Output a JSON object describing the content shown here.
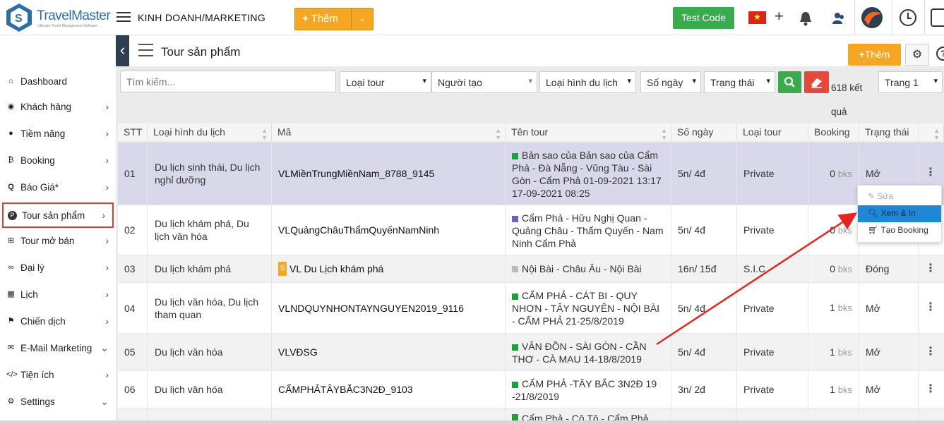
{
  "topbar": {
    "logo_text": "TravelMaster",
    "logo_sub": "Ultimate Travel Management Software",
    "section": "KINH DOANH/MARKETING",
    "add_label": "Thêm",
    "test_code": "Test Code"
  },
  "sidebar": {
    "items": [
      {
        "label": "Dashboard",
        "icon": "home-icon",
        "arrow": ""
      },
      {
        "label": "Khách hàng",
        "icon": "user-circle-icon",
        "arrow": "›"
      },
      {
        "label": "Tiềm năng",
        "icon": "chat-icon",
        "arrow": "›"
      },
      {
        "label": "Booking",
        "icon": "bitcoin-icon",
        "arrow": "›"
      },
      {
        "label": "Báo Giá*",
        "icon": "quote-icon",
        "arrow": "›"
      },
      {
        "label": "Tour sản phẩm",
        "icon": "product-icon",
        "arrow": "›"
      },
      {
        "label": "Tour mở bán",
        "icon": "sitemap-icon",
        "arrow": "›"
      },
      {
        "label": "Đại lý",
        "icon": "handshake-icon",
        "arrow": "›"
      },
      {
        "label": "Lịch",
        "icon": "calendar-icon",
        "arrow": "›"
      },
      {
        "label": "Chiến dịch",
        "icon": "flag-icon",
        "arrow": "›"
      },
      {
        "label": "E-Mail Marketing",
        "icon": "mail-icon",
        "arrow": "⌄"
      },
      {
        "label": "Tiện ích",
        "icon": "code-icon",
        "arrow": "›"
      },
      {
        "label": "Settings",
        "icon": "cogs-icon",
        "arrow": "⌄"
      }
    ]
  },
  "page": {
    "title": "Tour sản phẩm",
    "add_label": "Thêm"
  },
  "filters": {
    "search_placeholder": "Tìm kiếm...",
    "loai_tour": "Loại tour",
    "nguoi_tao": "Người tạo",
    "loai_hinh": "Loại hình du lịch",
    "so_ngay": "Số ngày",
    "trang_thai": "Trạng thái",
    "result_count": "618 kết quả",
    "page": "Trang 1"
  },
  "table": {
    "headers": [
      "STT",
      "Loại hình du lịch",
      "Mã",
      "Tên tour",
      "Số ngày",
      "Loại tour",
      "Booking",
      "Trạng thái"
    ],
    "rows": [
      {
        "stt": "01",
        "loai_hinh": "Du lịch sinh thái, Du lịch nghỉ dưỡng",
        "ma": "VLMiềnTrungMiềnNam_8788_9145",
        "ten": "Bản sao của Bản sao của Cẩm Phả - Đà Nẵng - Vũng Tàu - Sài Gòn - Cẩm Phả 01-09-2021 13:17 17-09-2021 08:25",
        "color": "#1aa33a",
        "so_ngay": "5n/ 4đ",
        "loai_tour": "Private",
        "booking": "0",
        "unit": "bks",
        "trang_thai": "Mở"
      },
      {
        "stt": "02",
        "loai_hinh": "Du lịch khám phá, Du lịch văn hóa",
        "ma": "VLQuảngChâuThẩmQuyếnNamNinh",
        "ten": "Cẩm Phả - Hữu Nghị Quan - Quảng Châu - Thẩm Quyến - Nam Ninh Cẩm Phả",
        "color": "#6b5fc7",
        "so_ngay": "5n/ 4đ",
        "loai_tour": "Private",
        "booking": "0",
        "unit": "bks",
        "trang_thai": ""
      },
      {
        "stt": "03",
        "loai_hinh": "Du lịch khám phá",
        "ma": "VL Du Lịch khám phá",
        "ten": "Nội Bài - Châu Âu - Nội Bài",
        "color": "#bbbbbb",
        "so_ngay": "16n/ 15đ",
        "loai_tour": "S.I.C",
        "booking": "0",
        "unit": "bks",
        "trang_thai": "Đóng",
        "tag": "S"
      },
      {
        "stt": "04",
        "loai_hinh": "Du lịch văn hóa, Du lịch tham quan",
        "ma": "VLNDQUYNHONTAYNGUYEN2019_9116",
        "ten": "CẨM PHẢ - CÁT BI - QUY NHƠN - TÂY NGUYÊN - NỘI BÀI - CẨM PHẢ 21-25/8/2019",
        "color": "#1aa33a",
        "so_ngay": "5n/ 4đ",
        "loai_tour": "Private",
        "booking": "1",
        "unit": "bks",
        "trang_thai": "Mở"
      },
      {
        "stt": "05",
        "loai_hinh": "Du lịch văn hóa",
        "ma": "VLVĐSG",
        "ten": "VÂN ĐỒN - SÀI GÒN - CẦN THƠ - CÀ MAU 14-18/8/2019",
        "color": "#1aa33a",
        "so_ngay": "5n/ 4đ",
        "loai_tour": "Private",
        "booking": "1",
        "unit": "bks",
        "trang_thai": "Mở"
      },
      {
        "stt": "06",
        "loai_hinh": "Du lịch văn hóa",
        "ma": "CẨMPHẢTÂYBẮC3N2Đ_9103",
        "ten": "CẨM PHẢ -TÂY BẮC 3N2Đ 19 -21/8/2019",
        "color": "#1aa33a",
        "so_ngay": "3n/ 2đ",
        "loai_tour": "Private",
        "booking": "1",
        "unit": "bks",
        "trang_thai": "Mở"
      },
      {
        "stt": "",
        "loai_hinh": "",
        "ma": "",
        "ten": "Cẩm Phả - Cô Tô - Cẩm Phả",
        "color": "#1aa33a",
        "so_ngay": "",
        "loai_tour": "",
        "booking": "",
        "unit": "",
        "trang_thai": ""
      }
    ]
  },
  "context_menu": {
    "edit": "Sửa",
    "view_print": "Xem & In",
    "create_booking": "Tạo Booking"
  },
  "colors": {
    "accent_orange": "#f5a623",
    "green": "#3aaa4f",
    "red": "#e24b3b",
    "selected_row": "#d9d7ea",
    "highlight": "#1e88d6"
  }
}
